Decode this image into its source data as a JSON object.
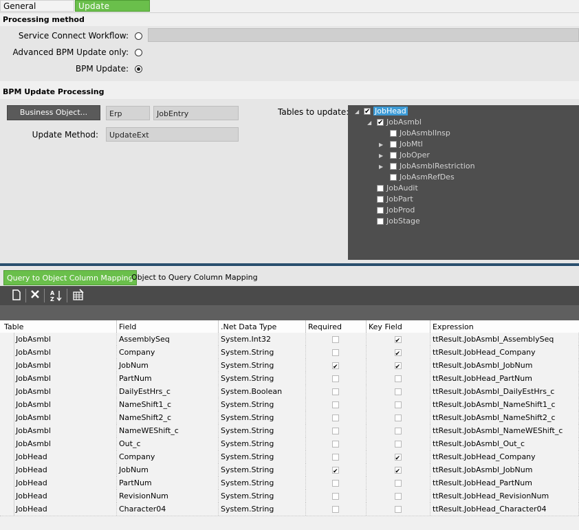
{
  "tabs": [
    {
      "label": "General Properties",
      "active": false
    },
    {
      "label": "Update  Processing",
      "active": true
    }
  ],
  "processing_method": {
    "header": "Processing method",
    "options": [
      {
        "label": "Service Connect Workflow:",
        "selected": false
      },
      {
        "label": "Advanced BPM Update only:",
        "selected": false
      },
      {
        "label": "BPM Update:",
        "selected": true
      }
    ],
    "workflow_value": ""
  },
  "bpm_update": {
    "header": "BPM Update Processing",
    "business_object_button": "Business Object...",
    "bo_system": "Erp",
    "bo_name": "JobEntry",
    "update_method_label": "Update Method:",
    "update_method_value": "UpdateExt",
    "tables_label": "Tables to update:"
  },
  "tree": {
    "JobHead": "JobHead",
    "JobAsmbl": "JobAsmbl",
    "JobAsmblInsp": "JobAsmblInsp",
    "JobMtl": "JobMtl",
    "JobOper": "JobOper",
    "JobAsmblRestriction": "JobAsmblRestriction",
    "JobAsmRefDes": "JobAsmRefDes",
    "JobAudit": "JobAudit",
    "JobPart": "JobPart",
    "JobProd": "JobProd",
    "JobStage": "JobStage"
  },
  "mapping_tabs": [
    {
      "label": "Query to Object Column Mapping",
      "active": true
    },
    {
      "label": "Object to Query Column Mapping",
      "active": false
    }
  ],
  "toolbar": [
    "new-icon",
    "delete-icon",
    "sort-icon",
    "grid-settings-icon"
  ],
  "grid": {
    "columns": [
      "Table",
      "Field",
      ".Net Data Type",
      "Required",
      "Key Field",
      "Expression"
    ],
    "rows": [
      {
        "table": "JobAsmbl",
        "field": "AssemblySeq",
        "type": "System.Int32",
        "required": false,
        "key": true,
        "expr": "ttResult.JobAsmbl_AssemblySeq"
      },
      {
        "table": "JobAsmbl",
        "field": "Company",
        "type": "System.String",
        "required": false,
        "key": true,
        "expr": "ttResult.JobHead_Company"
      },
      {
        "table": "JobAsmbl",
        "field": "JobNum",
        "type": "System.String",
        "required": true,
        "key": true,
        "expr": "ttResult.JobAsmbl_JobNum"
      },
      {
        "table": "JobAsmbl",
        "field": "PartNum",
        "type": "System.String",
        "required": false,
        "key": false,
        "expr": "ttResult.JobHead_PartNum"
      },
      {
        "table": "JobAsmbl",
        "field": "DailyEstHrs_c",
        "type": "System.Boolean",
        "required": false,
        "key": false,
        "expr": "ttResult.JobAsmbl_DailyEstHrs_c"
      },
      {
        "table": "JobAsmbl",
        "field": "NameShift1_c",
        "type": "System.String",
        "required": false,
        "key": false,
        "expr": "ttResult.JobAsmbl_NameShift1_c"
      },
      {
        "table": "JobAsmbl",
        "field": "NameShift2_c",
        "type": "System.String",
        "required": false,
        "key": false,
        "expr": "ttResult.JobAsmbl_NameShift2_c"
      },
      {
        "table": "JobAsmbl",
        "field": "NameWEShift_c",
        "type": "System.String",
        "required": false,
        "key": false,
        "expr": "ttResult.JobAsmbl_NameWEShift_c"
      },
      {
        "table": "JobAsmbl",
        "field": "Out_c",
        "type": "System.String",
        "required": false,
        "key": false,
        "expr": "ttResult.JobAsmbl_Out_c"
      },
      {
        "table": "JobHead",
        "field": "Company",
        "type": "System.String",
        "required": false,
        "key": true,
        "expr": "ttResult.JobHead_Company"
      },
      {
        "table": "JobHead",
        "field": "JobNum",
        "type": "System.String",
        "required": true,
        "key": true,
        "expr": "ttResult.JobAsmbl_JobNum"
      },
      {
        "table": "JobHead",
        "field": "PartNum",
        "type": "System.String",
        "required": false,
        "key": false,
        "expr": "ttResult.JobHead_PartNum"
      },
      {
        "table": "JobHead",
        "field": "RevisionNum",
        "type": "System.String",
        "required": false,
        "key": false,
        "expr": "ttResult.JobHead_RevisionNum"
      },
      {
        "table": "JobHead",
        "field": "Character04",
        "type": "System.String",
        "required": false,
        "key": false,
        "expr": "ttResult.JobHead_Character04"
      }
    ]
  }
}
